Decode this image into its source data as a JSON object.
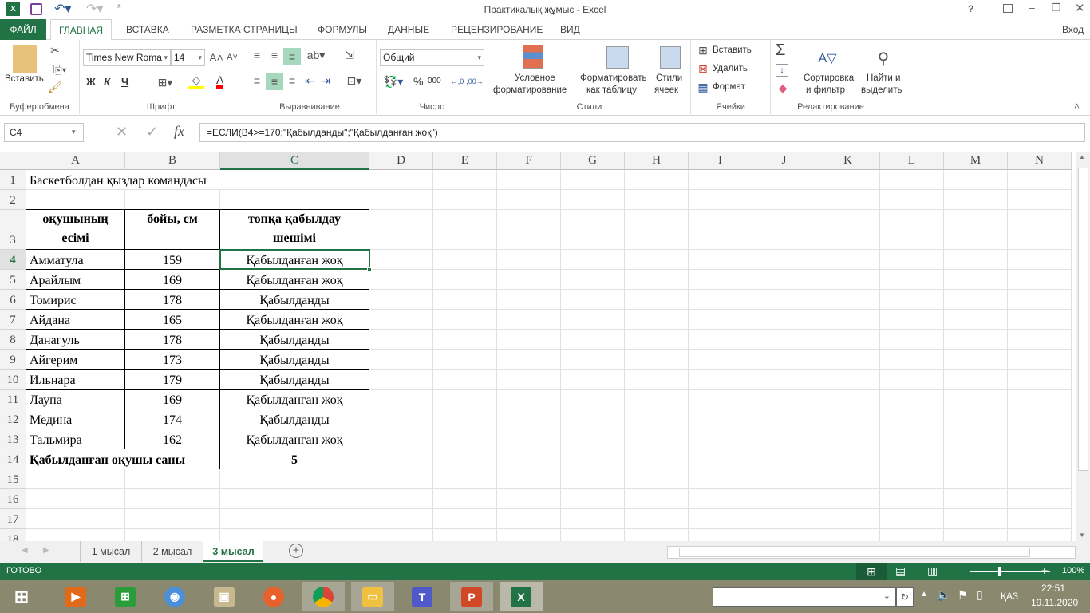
{
  "window": {
    "title": "Практикалық жұмыс - Excel",
    "help": "?",
    "signin": "Вход"
  },
  "ribbon_tabs": [
    "ФАЙЛ",
    "ГЛАВНАЯ",
    "ВСТАВКА",
    "РАЗМЕТКА СТРАНИЦЫ",
    "ФОРМУЛЫ",
    "ДАННЫЕ",
    "РЕЦЕНЗИРОВАНИЕ",
    "ВИД"
  ],
  "active_tab": "ГЛАВНАЯ",
  "ribbon": {
    "clipboard": {
      "label": "Буфер обмена",
      "paste": "Вставить"
    },
    "font": {
      "label": "Шрифт",
      "name": "Times New Roma",
      "size": "14",
      "bold": "Ж",
      "italic": "К",
      "underline": "Ч",
      "font_color": "A",
      "fill_color_hex": "#ffff00",
      "font_color_hex": "#ff0000"
    },
    "alignment": {
      "label": "Выравнивание"
    },
    "number": {
      "label": "Число",
      "format": "Общий",
      "percent": "%",
      "thousands": "000"
    },
    "styles": {
      "label": "Стили",
      "conditional": [
        "Условное",
        "форматирование"
      ],
      "format_table": [
        "Форматировать",
        "как таблицу"
      ],
      "cell_styles": [
        "Стили",
        "ячеек"
      ]
    },
    "cells": {
      "label": "Ячейки",
      "insert": "Вставить",
      "delete": "Удалить",
      "format": "Формат"
    },
    "editing": {
      "label": "Редактирование",
      "sum": "Σ",
      "sort": [
        "Сортировка",
        "и фильтр"
      ],
      "find": [
        "Найти и",
        "выделить"
      ]
    }
  },
  "formula_bar": {
    "name_box": "C4",
    "formula": "=ЕСЛИ(B4>=170;\"Қабылданды\";\"Қабылданған жоқ\")"
  },
  "columns": [
    "A",
    "B",
    "C",
    "D",
    "E",
    "F",
    "G",
    "H",
    "I",
    "J",
    "K",
    "L",
    "M",
    "N"
  ],
  "rows": [
    "1",
    "2",
    "3",
    "4",
    "5",
    "6",
    "7",
    "8",
    "9",
    "10",
    "11",
    "12",
    "13",
    "14",
    "15",
    "16",
    "17",
    "18"
  ],
  "selected_cell": "C4",
  "sheet": {
    "title": "Баскетболдан қыздар командасы",
    "headers": [
      "оқушының есімі",
      "бойы, см",
      "топқа қабылдау шешімі"
    ],
    "data": [
      [
        "Амматула",
        "159",
        "Қабылданған жоқ"
      ],
      [
        "Арайлым",
        "169",
        "Қабылданған жоқ"
      ],
      [
        "Томирис",
        "178",
        "Қабылданды"
      ],
      [
        "Айдана",
        "165",
        "Қабылданған жоқ"
      ],
      [
        "Данагуль",
        "178",
        "Қабылданды"
      ],
      [
        "Айгерим",
        "173",
        "Қабылданды"
      ],
      [
        "Ильнара",
        "179",
        "Қабылданды"
      ],
      [
        "Лаупа",
        "169",
        "Қабылданған жоқ"
      ],
      [
        "Медина",
        "174",
        "Қабылданды"
      ],
      [
        "Тальмира",
        "162",
        "Қабылданған жоқ"
      ]
    ],
    "total_label": "Қабылданған оқушы саны",
    "total_value": "5"
  },
  "sheet_tabs": [
    "1 мысал",
    "2 мысал",
    "3 мысал"
  ],
  "active_sheet": "3 мысал",
  "status": {
    "ready": "ГОТОВО",
    "zoom": "100%",
    "zoom_level_percent": 100
  },
  "taskbar": {
    "lang": "ҚАЗ",
    "time": "22:51",
    "date": "19.11.2020"
  },
  "colors": {
    "excel_green": "#217346"
  }
}
